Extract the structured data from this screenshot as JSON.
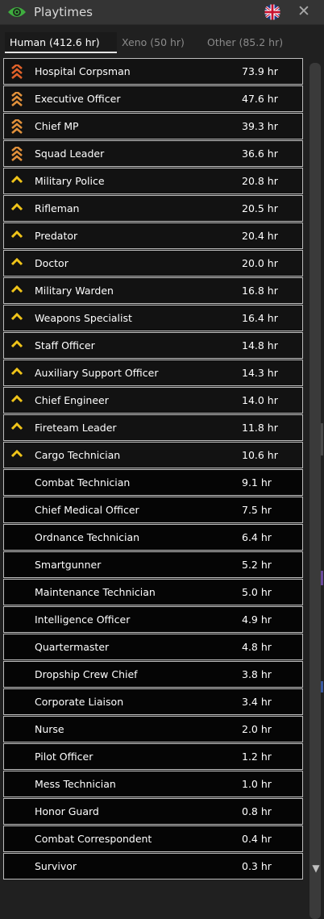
{
  "window": {
    "title": "Playtimes",
    "close_label": "✕"
  },
  "tabs": [
    {
      "label": "Human (412.6 hr)",
      "active": true
    },
    {
      "label": "Xeno (50 hr)",
      "active": false
    },
    {
      "label": "Other (85.2 hr)",
      "active": false
    }
  ],
  "colors": {
    "rank_high": "#e1622a",
    "rank_mid": "#e2913b",
    "rank_low": "#f0c419",
    "row_border": "#bdbdbd"
  },
  "rows": [
    {
      "name": "Hospital Corpsman",
      "hours": "73.9 hr",
      "icon": "rank-triple-chevron-red-icon"
    },
    {
      "name": "Executive Officer",
      "hours": "47.6 hr",
      "icon": "rank-triple-chevron-orange-icon"
    },
    {
      "name": "Chief MP",
      "hours": "39.3 hr",
      "icon": "rank-triple-chevron-orange-icon"
    },
    {
      "name": "Squad Leader",
      "hours": "36.6 hr",
      "icon": "rank-triple-chevron-orange-icon"
    },
    {
      "name": "Military Police",
      "hours": "20.8 hr",
      "icon": "rank-chevron-gold-icon"
    },
    {
      "name": "Rifleman",
      "hours": "20.5 hr",
      "icon": "rank-chevron-gold-icon"
    },
    {
      "name": "Predator",
      "hours": "20.4 hr",
      "icon": "rank-chevron-gold-icon"
    },
    {
      "name": "Doctor",
      "hours": "20.0 hr",
      "icon": "rank-chevron-gold-icon"
    },
    {
      "name": "Military Warden",
      "hours": "16.8 hr",
      "icon": "rank-chevron-gold-icon"
    },
    {
      "name": "Weapons Specialist",
      "hours": "16.4 hr",
      "icon": "rank-chevron-gold-icon"
    },
    {
      "name": "Staff Officer",
      "hours": "14.8 hr",
      "icon": "rank-chevron-gold-icon"
    },
    {
      "name": "Auxiliary Support Officer",
      "hours": "14.3 hr",
      "icon": "rank-chevron-gold-icon"
    },
    {
      "name": "Chief Engineer",
      "hours": "14.0 hr",
      "icon": "rank-chevron-gold-icon"
    },
    {
      "name": "Fireteam Leader",
      "hours": "11.8 hr",
      "icon": "rank-chevron-gold-icon"
    },
    {
      "name": "Cargo Technician",
      "hours": "10.6 hr",
      "icon": "rank-chevron-gold-icon"
    },
    {
      "name": "Combat Technician",
      "hours": "9.1 hr",
      "icon": ""
    },
    {
      "name": "Chief Medical Officer",
      "hours": "7.5 hr",
      "icon": ""
    },
    {
      "name": "Ordnance Technician",
      "hours": "6.4 hr",
      "icon": ""
    },
    {
      "name": "Smartgunner",
      "hours": "5.2 hr",
      "icon": ""
    },
    {
      "name": "Maintenance Technician",
      "hours": "5.0 hr",
      "icon": ""
    },
    {
      "name": "Intelligence Officer",
      "hours": "4.9 hr",
      "icon": ""
    },
    {
      "name": "Quartermaster",
      "hours": "4.8 hr",
      "icon": ""
    },
    {
      "name": "Dropship Crew Chief",
      "hours": "3.8 hr",
      "icon": ""
    },
    {
      "name": "Corporate Liaison",
      "hours": "3.4 hr",
      "icon": ""
    },
    {
      "name": "Nurse",
      "hours": "2.0 hr",
      "icon": ""
    },
    {
      "name": "Pilot Officer",
      "hours": "1.2 hr",
      "icon": ""
    },
    {
      "name": "Mess Technician",
      "hours": "1.0 hr",
      "icon": ""
    },
    {
      "name": "Honor Guard",
      "hours": "0.8 hr",
      "icon": ""
    },
    {
      "name": "Combat Correspondent",
      "hours": "0.4 hr",
      "icon": ""
    },
    {
      "name": "Survivor",
      "hours": "0.3 hr",
      "icon": ""
    }
  ]
}
